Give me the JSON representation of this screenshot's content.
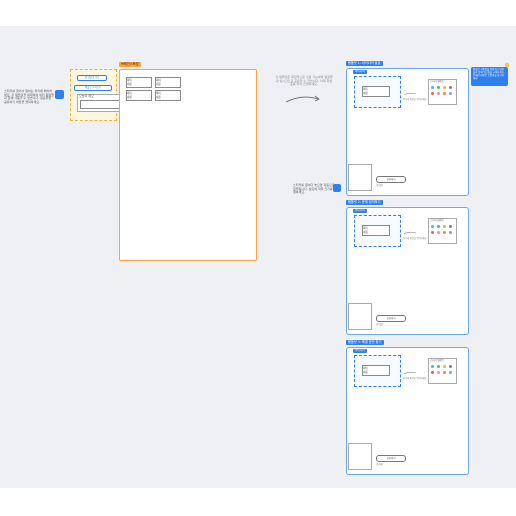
{
  "canvas": {
    "background": "#eef0f3"
  },
  "left_note": {
    "text": "스티커를 끌어서 원하는 위치에 배치하세요. 각 템플릿을 복제하여 여러 팀원들과 함께 사용할 수 있습니다. 완료되면 공유하기 버튼을 클릭하세요."
  },
  "toolbar_group": {
    "button1": "새 템플릿 추가",
    "button2": "템플릿 가져오기",
    "card_title": "오늘의 메모"
  },
  "main_frame": {
    "tab": "브레인스토밍",
    "boxes": [
      {
        "l1": "제목",
        "l2": "내용"
      },
      {
        "l1": "제목",
        "l2": "내용"
      },
      {
        "l1": "제목",
        "l2": "내용"
      },
      {
        "l1": "제목",
        "l2": "내용"
      }
    ]
  },
  "center_note": {
    "text": "각 템플릿은 독립적으로 사용 가능하며 팀원들과 실시간으로 공유할 수 있습니다. 아래 화살표를 따라 진행하세요."
  },
  "side_note": {
    "text": "스티커를 끌어다 놓으면 자동으로 정렬됩니다. 필요에 따라 크기를 조절하세요."
  },
  "top_right_card": {
    "text": "템플릿 사용법을 확인하고 팀원들과 함께 워크숍을 시작하세요. 자세한 내용은 도움말을 참고하세요."
  },
  "templates": [
    {
      "tab": "템플릿 1: 아이디어 발굴",
      "sub_tab": "아이디어",
      "input_l1": "제목",
      "input_l2": "내용",
      "mid_caption": "여기에 의견을 입력하세요",
      "palette_title": "스티커 팔레트",
      "action_button": "공유하기",
      "action_link": "초기화"
    },
    {
      "tab": "템플릿 2: 문제 정의하기",
      "sub_tab": "아이디어",
      "input_l1": "제목",
      "input_l2": "내용",
      "mid_caption": "여기에 의견을 입력하세요",
      "palette_title": "스티커 팔레트",
      "action_button": "공유하기",
      "action_link": "초기화"
    },
    {
      "tab": "템플릿 3: 해결 방안 찾기",
      "sub_tab": "아이디어",
      "input_l1": "제목",
      "input_l2": "내용",
      "mid_caption": "여기에 의견을 입력하세요",
      "palette_title": "스티커 팔레트",
      "action_button": "공유하기",
      "action_link": "초기화"
    }
  ],
  "palette_colors": [
    "#4fb3e8",
    "#3fc27a",
    "#f2b23a",
    "#8e6be3",
    "#ef5b5b",
    "#f38ac1",
    "#f28a3a",
    "#5bb0e8"
  ]
}
